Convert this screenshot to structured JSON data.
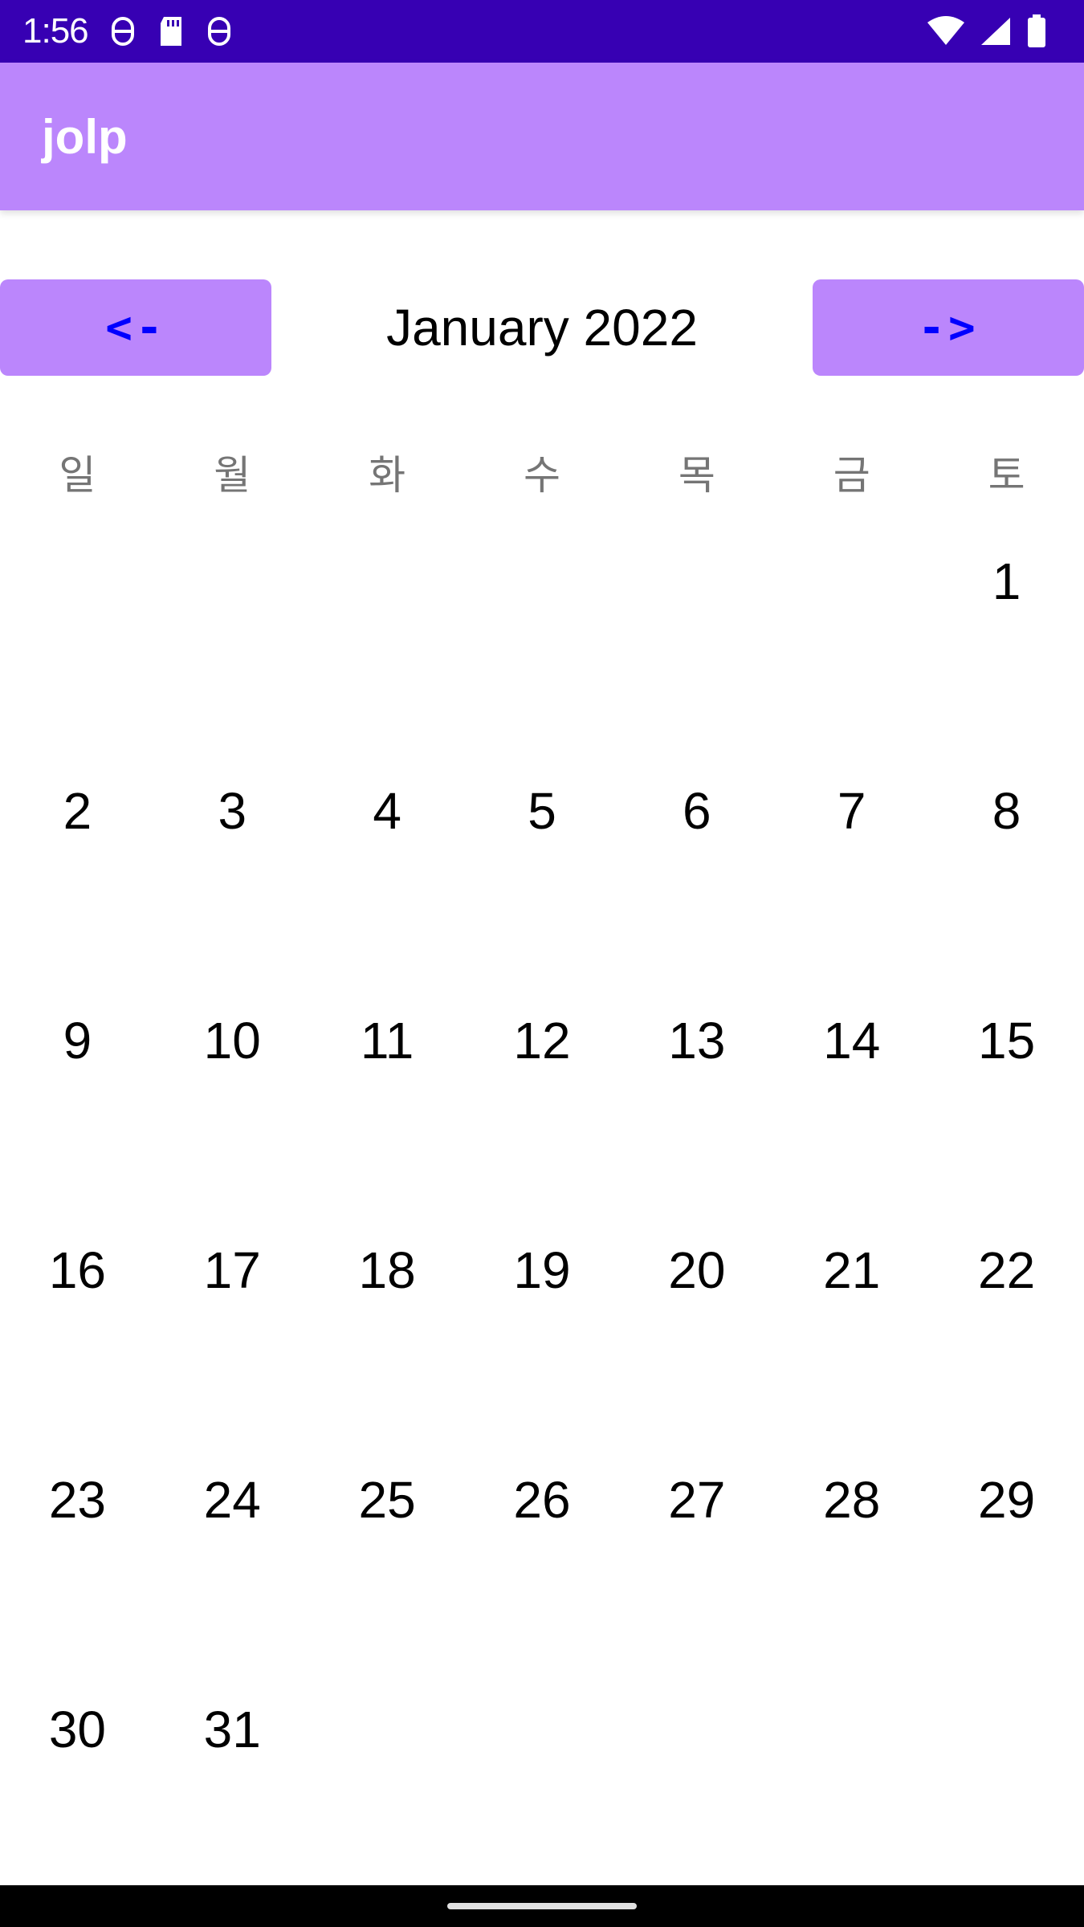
{
  "status_bar": {
    "time": "1:56",
    "left_icons": [
      "notification-icon",
      "sd-card-icon",
      "notification-icon"
    ],
    "right_icons": [
      "wifi-icon",
      "cell-signal-icon",
      "battery-icon"
    ]
  },
  "app_bar": {
    "title": "jolp",
    "color": "#bb86fc"
  },
  "calendar": {
    "prev_label": "<-",
    "next_label": "->",
    "month_label": "January 2022",
    "weekdays": [
      "일",
      "월",
      "화",
      "수",
      "목",
      "금",
      "토"
    ],
    "days": [
      "",
      "",
      "",
      "",
      "",
      "",
      "1",
      "2",
      "3",
      "4",
      "5",
      "6",
      "7",
      "8",
      "9",
      "10",
      "11",
      "12",
      "13",
      "14",
      "15",
      "16",
      "17",
      "18",
      "19",
      "20",
      "21",
      "22",
      "23",
      "24",
      "25",
      "26",
      "27",
      "28",
      "29",
      "30",
      "31",
      "",
      "",
      "",
      "",
      ""
    ]
  },
  "colors": {
    "status_bar": "#3700b3",
    "accent": "#bb86fc",
    "button_text": "#0000ff"
  }
}
